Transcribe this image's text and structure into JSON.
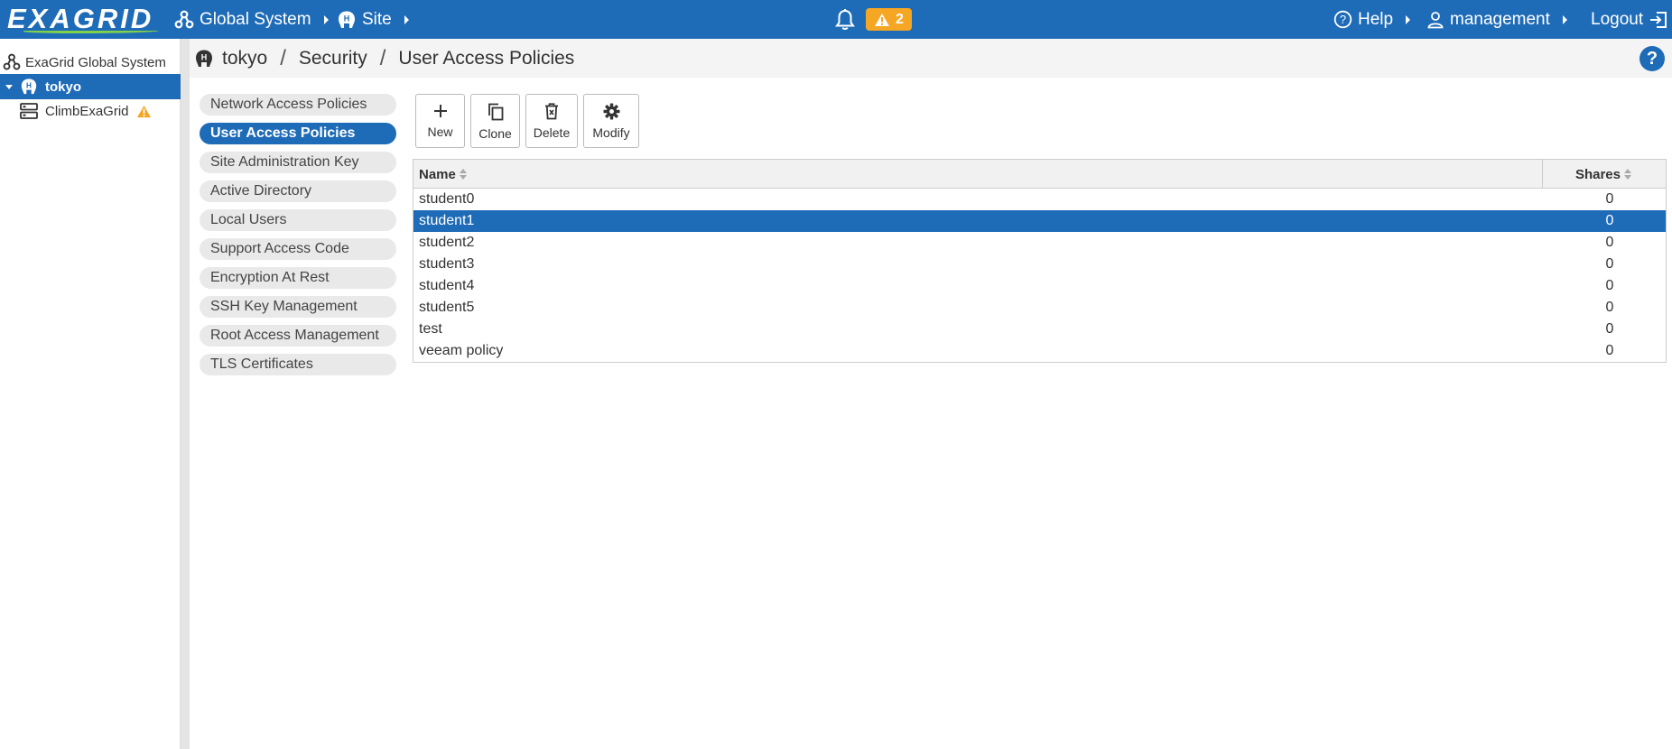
{
  "brand": {
    "logo_text": "EXAGRID",
    "accent": "#1e6bb8",
    "logo_accent": "#7fd14b",
    "alert_color": "#f5a623"
  },
  "topbar": {
    "global_system": "Global System",
    "site": "Site",
    "alert_count": "2",
    "help": "Help",
    "user": "management",
    "logout": "Logout"
  },
  "tree": {
    "root": "ExaGrid Global System",
    "site": "tokyo",
    "node": "ClimbExaGrid"
  },
  "breadcrumb": {
    "site": "tokyo",
    "section": "Security",
    "page": "User Access Policies",
    "help": "?"
  },
  "subnav": [
    {
      "label": "Network Access Policies",
      "active": false
    },
    {
      "label": "User Access Policies",
      "active": true
    },
    {
      "label": "Site Administration Key",
      "active": false
    },
    {
      "label": "Active Directory",
      "active": false
    },
    {
      "label": "Local Users",
      "active": false
    },
    {
      "label": "Support Access Code",
      "active": false
    },
    {
      "label": "Encryption At Rest",
      "active": false
    },
    {
      "label": "SSH Key Management",
      "active": false
    },
    {
      "label": "Root Access Management",
      "active": false
    },
    {
      "label": "TLS Certificates",
      "active": false
    }
  ],
  "toolbar": {
    "new": "New",
    "clone": "Clone",
    "delete": "Delete",
    "modify": "Modify"
  },
  "table": {
    "columns": [
      "Name",
      "Shares"
    ],
    "rows": [
      {
        "name": "student0",
        "shares": "0",
        "selected": false
      },
      {
        "name": "student1",
        "shares": "0",
        "selected": true
      },
      {
        "name": "student2",
        "shares": "0",
        "selected": false
      },
      {
        "name": "student3",
        "shares": "0",
        "selected": false
      },
      {
        "name": "student4",
        "shares": "0",
        "selected": false
      },
      {
        "name": "student5",
        "shares": "0",
        "selected": false
      },
      {
        "name": "test",
        "shares": "0",
        "selected": false
      },
      {
        "name": "veeam policy",
        "shares": "0",
        "selected": false
      }
    ]
  }
}
